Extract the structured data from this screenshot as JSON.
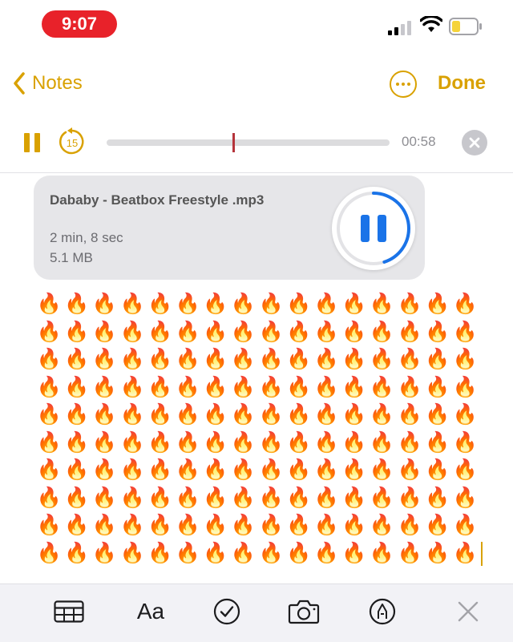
{
  "status_bar": {
    "time": "9:07",
    "colors": {
      "time_pill": "#e8222a",
      "battery_fill": "#f5d33a"
    },
    "icons": [
      "cellular-signal-icon",
      "wifi-icon",
      "battery-icon"
    ]
  },
  "nav": {
    "back_label": "Notes",
    "done_label": "Done",
    "accent_color": "#d9a100"
  },
  "player": {
    "elapsed": "00:58",
    "skip_seconds": "15",
    "progress_fraction": 0.45
  },
  "attachment": {
    "title": "Dababy - Beatbox Freestyle .mp3",
    "duration": "2 min, 8 sec",
    "size": "5.1 MB",
    "playback_progress_fraction": 0.45,
    "ring_color": "#1a73e8"
  },
  "note_body": {
    "emoji": "🔥",
    "rows": 10,
    "per_row": 16,
    "last_row_count": 16
  },
  "toolbar": {
    "format_label": "Aa",
    "icons": [
      "table-icon",
      "format-text-icon",
      "checklist-icon",
      "camera-icon",
      "markup-pen-icon",
      "close-icon"
    ]
  }
}
